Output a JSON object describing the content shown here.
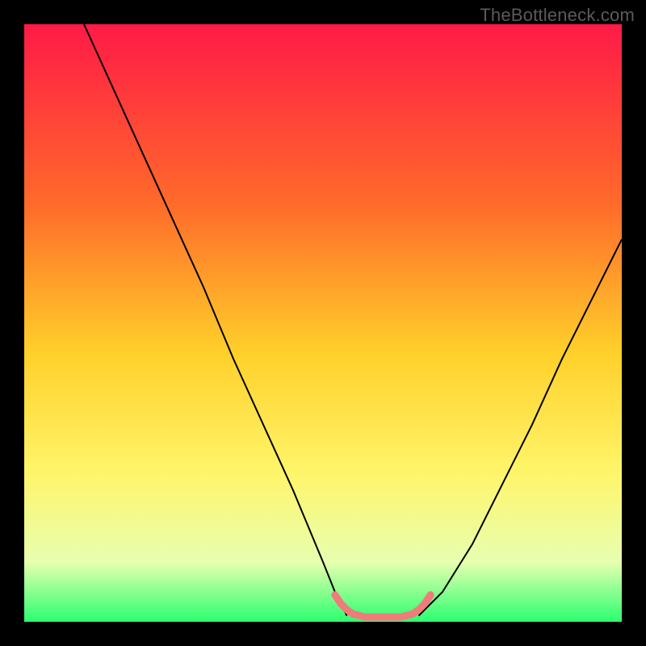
{
  "watermark": "TheBottleneck.com",
  "chart_data": {
    "type": "line",
    "title": "",
    "xlabel": "",
    "ylabel": "",
    "xlim": [
      0,
      100
    ],
    "ylim": [
      0,
      100
    ],
    "gradient_stops": [
      {
        "offset": 0,
        "color": "#ff1a47"
      },
      {
        "offset": 30,
        "color": "#ff6a2a"
      },
      {
        "offset": 55,
        "color": "#ffd02a"
      },
      {
        "offset": 75,
        "color": "#fff56a"
      },
      {
        "offset": 90,
        "color": "#e7ffb0"
      },
      {
        "offset": 100,
        "color": "#2bff6f"
      }
    ],
    "series": [
      {
        "name": "curve-left",
        "stroke": "#000000",
        "width": 2,
        "x": [
          10,
          15,
          20,
          25,
          30,
          35,
          40,
          45,
          50,
          52,
          54
        ],
        "values": [
          100,
          89,
          78,
          67,
          56,
          44,
          33,
          22,
          10,
          5,
          1
        ]
      },
      {
        "name": "curve-right",
        "stroke": "#000000",
        "width": 2,
        "x": [
          66,
          70,
          75,
          80,
          85,
          90,
          95,
          100
        ],
        "values": [
          1,
          5,
          13,
          23,
          33,
          44,
          54,
          64
        ]
      },
      {
        "name": "bottom-pink",
        "stroke": "#ef7b7b",
        "width": 9,
        "linecap": "round",
        "x": [
          52,
          53,
          54,
          55,
          57,
          60,
          63,
          65,
          66,
          67,
          68
        ],
        "values": [
          4.5,
          3.0,
          2.0,
          1.3,
          0.8,
          0.8,
          0.8,
          1.3,
          2.0,
          3.0,
          4.5
        ]
      }
    ]
  }
}
